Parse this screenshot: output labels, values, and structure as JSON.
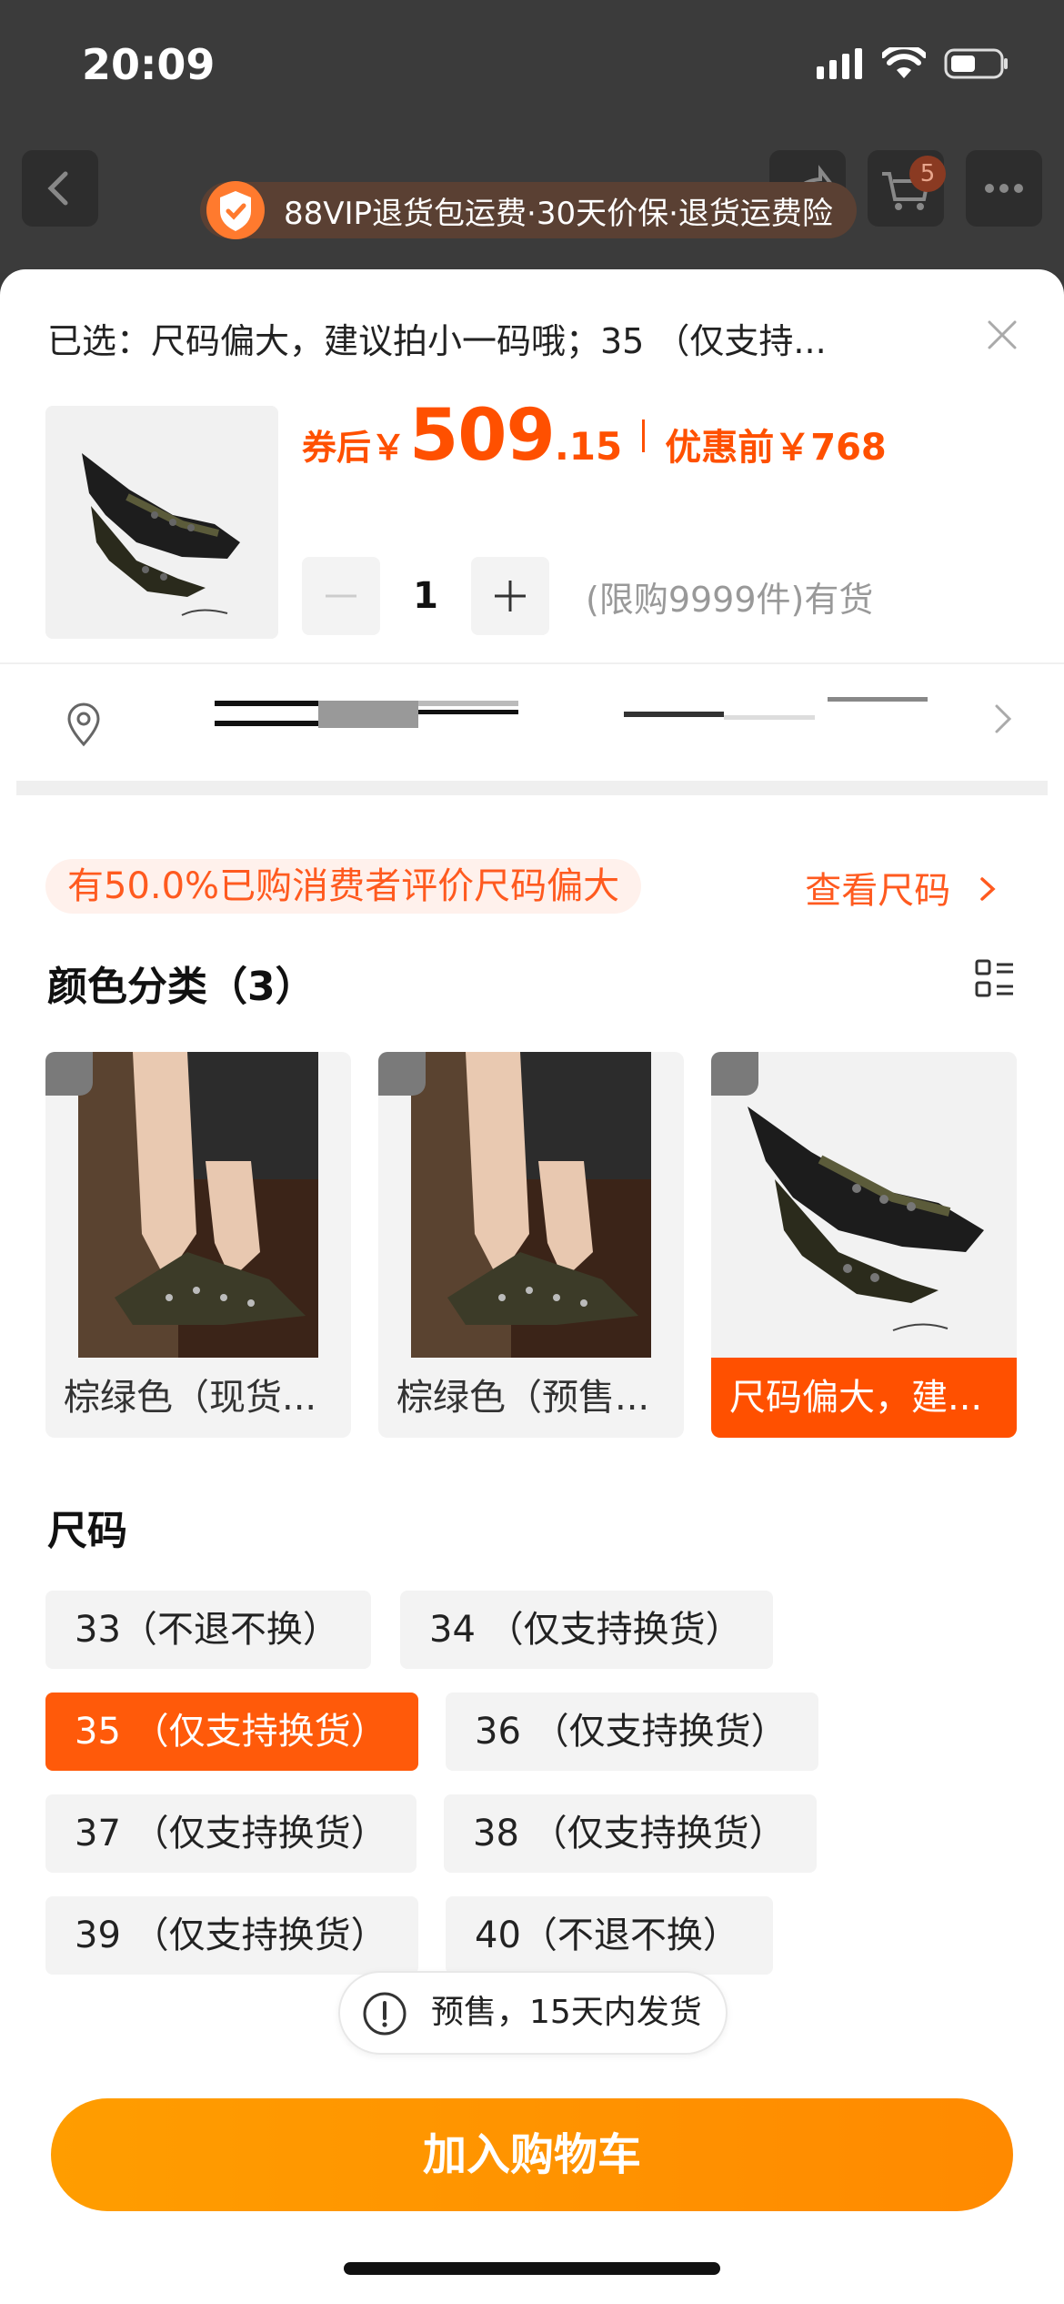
{
  "status_bar": {
    "time": "20:09"
  },
  "nav": {
    "cart_count": "5"
  },
  "vip_banner": {
    "text": "88VIP退货包运费·30天价保·退货运费险"
  },
  "sheet": {
    "selected_text": "已选：尺码偏大，建议拍小一码哦；35 （仅支持...",
    "price": {
      "after_label": "券后￥",
      "after_int": "509",
      "after_dec": ".15",
      "before_label": "优惠前￥768"
    },
    "quantity": {
      "value": "1",
      "stock_text": "(限购9999件)有货"
    },
    "size_hint": "有50.0%已购消费者评价尺码偏大",
    "size_link": "查看尺码",
    "color_section": {
      "title": "颜色分类（3）",
      "items": [
        {
          "label": "棕绿色（现货..."
        },
        {
          "label": "棕绿色（预售..."
        },
        {
          "label": "尺码偏大，建...",
          "selected": true
        }
      ]
    },
    "size_section": {
      "title": "尺码",
      "items": [
        {
          "label": "33（不退不换）"
        },
        {
          "label": "34 （仅支持换货）"
        },
        {
          "label": "35 （仅支持换货）",
          "selected": true
        },
        {
          "label": "36 （仅支持换货）"
        },
        {
          "label": "37 （仅支持换货）"
        },
        {
          "label": "38 （仅支持换货）"
        },
        {
          "label": "39 （仅支持换货）"
        },
        {
          "label": "40（不退不换）"
        }
      ]
    },
    "toast": "预售，15天内发货",
    "add_to_cart": "加入购物车"
  },
  "colors": {
    "accent": "#ff5000",
    "button": "#ff9500"
  }
}
